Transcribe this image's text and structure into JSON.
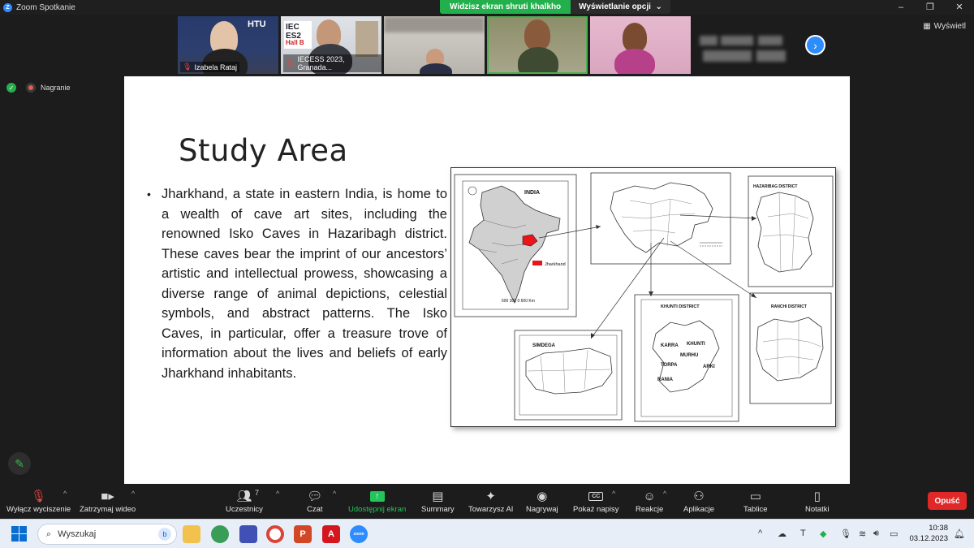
{
  "window": {
    "title": "Zoom Spotkanie",
    "controls": [
      "–",
      "❐",
      "✕"
    ]
  },
  "share_banner": {
    "viewing": "Widzisz ekran shruti khalkho",
    "options": "Wyświetlanie opcji"
  },
  "participants": [
    {
      "name": "Izabela Rataj",
      "muted": true
    },
    {
      "name": "IECESS 2023, Granada...",
      "muted": true
    },
    {
      "name": ""
    },
    {
      "name": ""
    },
    {
      "name": ""
    },
    {
      "name": ""
    }
  ],
  "thumb_overlays": {
    "htu": "HTU",
    "iecess": "IEC",
    "iecess_tail": "ES2",
    "hall": "Hall B"
  },
  "view_button": "Wyświetl",
  "status": {
    "recording": "Nagranie"
  },
  "slide": {
    "title": "Study Area",
    "bullet": "Jharkhand, a state in eastern India, is home to a wealth of cave art sites, including the renowned Isko Caves in Hazaribagh district. These caves bear the imprint of our ancestors’ artistic and intellectual prowess, showcasing a diverse range of animal depictions, celestial symbols, and abstract patterns. The Isko Caves, in particular, offer a treasure trove of information about the lives and beliefs of early Jharkhand inhabitants.",
    "map_labels": {
      "india": "INDIA",
      "jharkhand": "Jharkhand",
      "scale": "600 300  0        600 Km",
      "hazaribag": "HAZARIBAG DISTRICT",
      "khunti": "KHUNTI DISTRICT",
      "ranchi": "RANCHI DISTRICT",
      "simdega": "SIMDEGA",
      "karra": "KARRA",
      "khunti_town": "KHUNTI",
      "murhu": "MURHU",
      "torpa": "TORPA",
      "arki": "ARKI",
      "rania": "RANIA"
    }
  },
  "toolbar": {
    "items": [
      {
        "id": "mute",
        "label": "Wyłącz wyciszenie",
        "icon": "microphone-muted-icon"
      },
      {
        "id": "video",
        "label": "Zatrzymaj wideo",
        "icon": "video-camera-icon"
      },
      {
        "id": "participants",
        "label": "Uczestnicy",
        "icon": "participants-icon",
        "count": "7"
      },
      {
        "id": "chat",
        "label": "Czat",
        "icon": "chat-icon"
      },
      {
        "id": "share",
        "label": "Udostępnij ekran",
        "icon": "share-screen-icon"
      },
      {
        "id": "summary",
        "label": "Summary",
        "icon": "summary-icon"
      },
      {
        "id": "companion",
        "label": "Towarzysz AI",
        "icon": "ai-companion-icon"
      },
      {
        "id": "record",
        "label": "Nagrywaj",
        "icon": "record-icon"
      },
      {
        "id": "captions",
        "label": "Pokaż napisy",
        "icon": "captions-icon",
        "badge": "CC"
      },
      {
        "id": "reactions",
        "label": "Reakcje",
        "icon": "reactions-icon"
      },
      {
        "id": "apps",
        "label": "Aplikacje",
        "icon": "apps-icon"
      },
      {
        "id": "whiteboard",
        "label": "Tablice",
        "icon": "whiteboard-icon"
      },
      {
        "id": "notes",
        "label": "Notatki",
        "icon": "notes-icon"
      }
    ],
    "leave": "Opuść"
  },
  "taskbar": {
    "search_placeholder": "Wyszukaj",
    "time": "10:38",
    "date": "03.12.2023"
  },
  "colors": {
    "zoom_blue": "#2d8cff",
    "share_green": "#23b04c",
    "leave_red": "#e02828",
    "jharkhand_red": "#e8161b"
  }
}
